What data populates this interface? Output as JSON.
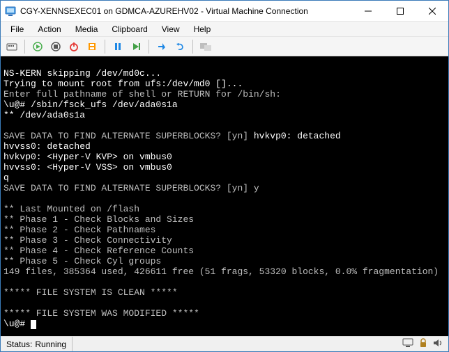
{
  "window": {
    "title": "CGY-XENNSEXEC01 on GDMCA-AZUREHV02 - Virtual Machine Connection"
  },
  "menu": {
    "file": "File",
    "action": "Action",
    "media": "Media",
    "clipboard": "Clipboard",
    "view": "View",
    "help": "Help"
  },
  "console": {
    "l0": "NS-KERN skipping /dev/md0c...",
    "l1": "Trying to mount root from ufs:/dev/md0 []...",
    "l2": "Enter full pathname of shell or RETURN for /bin/sh:",
    "l3": "\\u@# /sbin/fsck_ufs /dev/ada0s1a",
    "l4": "** /dev/ada0s1a",
    "l5": "",
    "l6a": "SAVE DATA TO FIND ALTERNATE SUPERBLOCKS? [yn] ",
    "l6b": "hvkvp0: detached",
    "l7": "hvvss0: detached",
    "l8": "hvkvp0: <Hyper-V KVP> on vmbus0",
    "l9": "hvvss0: <Hyper-V VSS> on vmbus0",
    "l10": "q",
    "l11": "SAVE DATA TO FIND ALTERNATE SUPERBLOCKS? [yn] y",
    "l12": "",
    "l13": "** Last Mounted on /flash",
    "l14": "** Phase 1 - Check Blocks and Sizes",
    "l15": "** Phase 2 - Check Pathnames",
    "l16": "** Phase 3 - Check Connectivity",
    "l17": "** Phase 4 - Check Reference Counts",
    "l18": "** Phase 5 - Check Cyl groups",
    "l19": "149 files, 385364 used, 426611 free (51 frags, 53320 blocks, 0.0% fragmentation)",
    "l20": "",
    "l21": "***** FILE SYSTEM IS CLEAN *****",
    "l22": "",
    "l23": "***** FILE SYSTEM WAS MODIFIED *****",
    "l24": "\\u@# "
  },
  "status": {
    "label": "Status:",
    "value": "Running"
  }
}
